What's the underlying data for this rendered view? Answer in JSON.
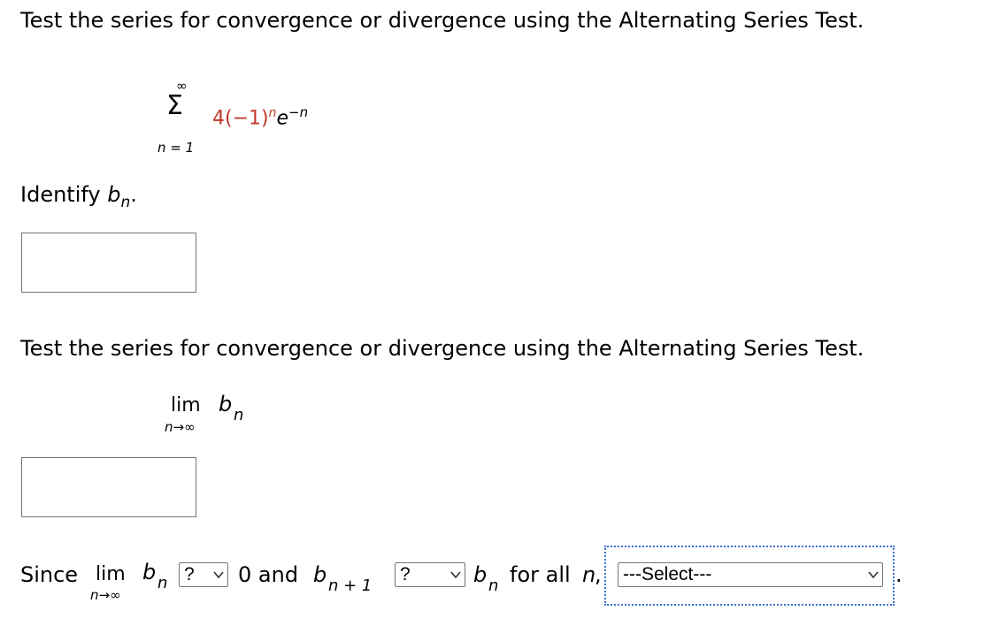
{
  "question1": {
    "prompt": "Test the series for convergence or divergence using the Alternating Series Test.",
    "series": {
      "upper_limit": "∞",
      "sigma": "Σ",
      "lower_limit": "n = 1",
      "term_coefficient": "4(−1)",
      "term_power_n": "n",
      "term_base": "e",
      "term_exponent": "−n"
    }
  },
  "identify": {
    "label": "Identify ",
    "var": "b",
    "sub": "n",
    "period": "."
  },
  "question2": {
    "prompt": "Test the series for convergence or divergence using the Alternating Series Test.",
    "limit": {
      "lim": "lim",
      "var": "b",
      "sub": "n",
      "under": "n→∞"
    }
  },
  "since": {
    "word": "Since",
    "lim": "lim",
    "var": "b",
    "sub": "n",
    "under": "n→∞",
    "select1": "?",
    "and_text": "0 and",
    "b_next_var": "b",
    "b_next_sub": "n + 1",
    "select2": "?",
    "b_var2": "b",
    "b_sub2": "n",
    "for_all": "for all",
    "n_var": "n",
    "comma": ",",
    "select3": "---Select---",
    "trailing": "."
  },
  "colors": {
    "accent_red": "#c0392b",
    "focus_blue": "#3b6fd8",
    "border": "#767676"
  }
}
